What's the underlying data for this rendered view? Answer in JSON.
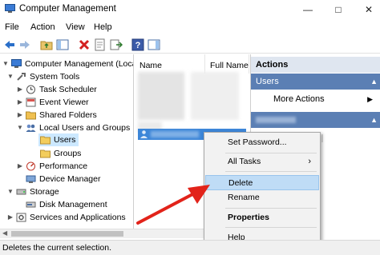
{
  "window": {
    "title": "Computer Management"
  },
  "menu": [
    "File",
    "Action",
    "View",
    "Help"
  ],
  "toolbar": {
    "icons": [
      "back-arrow-icon",
      "forward-arrow-icon",
      "up-folder-icon",
      "show-hide-tree-icon",
      "delete-icon",
      "properties-icon",
      "export-list-icon",
      "help-icon",
      "show-hide-action-pane-icon"
    ]
  },
  "tree": {
    "items": [
      {
        "label": "Computer Management (Local",
        "icon": "computer-management-icon"
      },
      {
        "label": "System Tools",
        "icon": "tools-icon"
      },
      {
        "label": "Task Scheduler",
        "icon": "clock-icon"
      },
      {
        "label": "Event Viewer",
        "icon": "event-viewer-icon"
      },
      {
        "label": "Shared Folders",
        "icon": "shared-folder-icon"
      },
      {
        "label": "Local Users and Groups",
        "icon": "users-icon"
      },
      {
        "label": "Users",
        "icon": "folder-icon"
      },
      {
        "label": "Groups",
        "icon": "folder-icon"
      },
      {
        "label": "Performance",
        "icon": "performance-icon"
      },
      {
        "label": "Device Manager",
        "icon": "device-manager-icon"
      },
      {
        "label": "Storage",
        "icon": "storage-icon"
      },
      {
        "label": "Disk Management",
        "icon": "disk-icon"
      },
      {
        "label": "Services and Applications",
        "icon": "services-icon"
      }
    ]
  },
  "list": {
    "columns": [
      "Name",
      "Full Name"
    ]
  },
  "actions": {
    "header": "Actions",
    "section": "Users",
    "more": "More Actions"
  },
  "context_menu": {
    "items": [
      "Set Password...",
      "All Tasks",
      "Delete",
      "Rename",
      "Properties",
      "Help"
    ]
  },
  "status": "Deletes the current selection.",
  "colors": {
    "selection": "#cce8ff",
    "highlight": "#bfdcf6",
    "arrow": "#e2231a"
  }
}
